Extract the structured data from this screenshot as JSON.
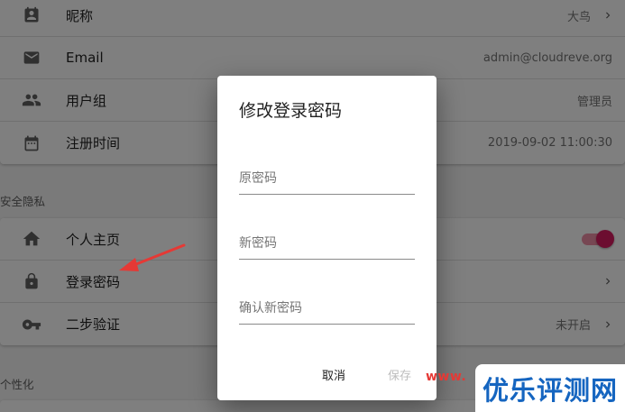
{
  "profile": {
    "rows": [
      {
        "label": "昵称",
        "value": "大鸟",
        "icon": "contact-card-icon"
      },
      {
        "label": "Email",
        "value": "admin@cloudreve.org",
        "icon": "mail-icon"
      },
      {
        "label": "用户组",
        "value": "管理员",
        "icon": "people-icon"
      },
      {
        "label": "注册时间",
        "value": "2019-09-02 11:00:30",
        "icon": "calendar-icon"
      }
    ]
  },
  "security": {
    "section_title": "安全隐私",
    "rows": [
      {
        "label": "个人主页",
        "icon": "home-icon",
        "toggle_on": true
      },
      {
        "label": "登录密码",
        "icon": "lock-icon"
      },
      {
        "label": "二步验证",
        "value": "未开启",
        "icon": "key-icon"
      }
    ]
  },
  "personalize": {
    "section_title": "个性化"
  },
  "dialog": {
    "title": "修改登录密码",
    "fields": [
      {
        "placeholder": "原密码"
      },
      {
        "placeholder": "新密码"
      },
      {
        "placeholder": "确认新密码"
      }
    ],
    "cancel_label": "取消",
    "save_label": "保存"
  },
  "watermark": {
    "url": "www.",
    "brand": "优乐评测网"
  },
  "colors": {
    "accent_toggle": "#d81b60",
    "annotation_arrow": "#e53935",
    "watermark_brand": "#1565c0"
  }
}
